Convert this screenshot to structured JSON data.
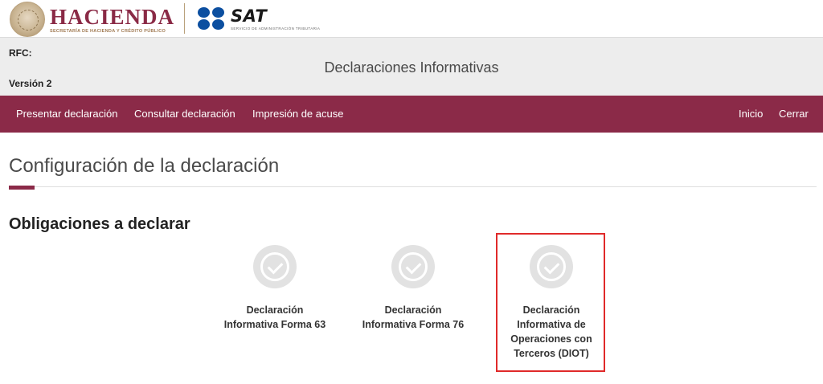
{
  "branding": {
    "hacienda_title": "HACIENDA",
    "hacienda_subtitle": "SECRETARÍA DE HACIENDA Y CRÉDITO PÚBLICO",
    "sat_title": "SAT",
    "sat_subtitle": "SERVICIO DE ADMINISTRACIÓN TRIBUTARIA",
    "colors": {
      "brand": "#8b2a48",
      "sat_blue": "#0c4fa0",
      "highlight": "#e02a2a"
    }
  },
  "header": {
    "rfc_label": "RFC:",
    "version_label": "Versión 2",
    "app_title": "Declaraciones Informativas"
  },
  "navbar": {
    "left_items": [
      "Presentar declaración",
      "Consultar declaración",
      "Impresión de acuse"
    ],
    "right_items": [
      "Inicio",
      "Cerrar"
    ]
  },
  "main": {
    "page_title": "Configuración de la declaración",
    "section_title": "Obligaciones a declarar",
    "obligations": [
      {
        "lines": [
          "Declaración",
          "Informativa Forma 63"
        ],
        "icon": "check-circle-icon",
        "highlighted": false
      },
      {
        "lines": [
          "Declaración",
          "Informativa Forma 76"
        ],
        "icon": "check-circle-icon",
        "highlighted": false
      },
      {
        "lines": [
          "Declaración",
          "Informativa de",
          "Operaciones con",
          "Terceros (DIOT)"
        ],
        "icon": "check-circle-icon",
        "highlighted": true
      }
    ]
  }
}
